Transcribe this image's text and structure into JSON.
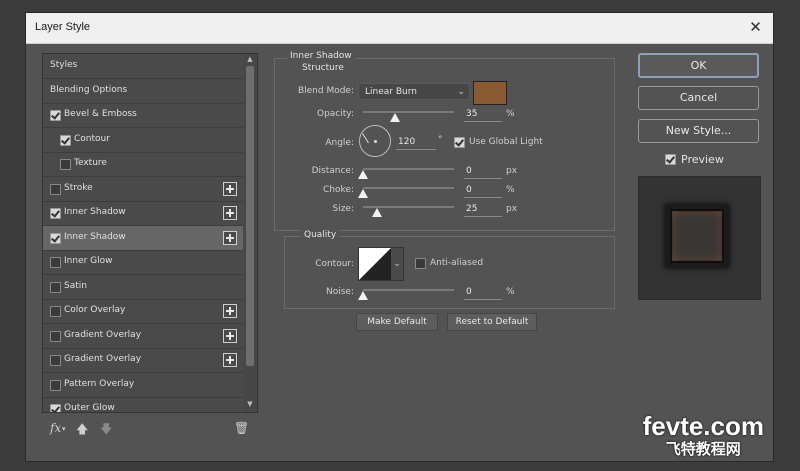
{
  "dialog": {
    "title": "Layer Style",
    "close_glyph": "✕"
  },
  "styles_list": {
    "items": [
      {
        "label": "Styles",
        "checkbox": null,
        "plus": false,
        "selected": false,
        "indent": 0
      },
      {
        "label": "Blending Options",
        "checkbox": null,
        "plus": false,
        "selected": false,
        "indent": 0
      },
      {
        "label": "Bevel & Emboss",
        "checkbox": true,
        "plus": false,
        "selected": false,
        "indent": 0
      },
      {
        "label": "Contour",
        "checkbox": true,
        "plus": false,
        "selected": false,
        "indent": 1
      },
      {
        "label": "Texture",
        "checkbox": false,
        "plus": false,
        "selected": false,
        "indent": 1
      },
      {
        "label": "Stroke",
        "checkbox": false,
        "plus": true,
        "selected": false,
        "indent": 0
      },
      {
        "label": "Inner Shadow",
        "checkbox": true,
        "plus": true,
        "selected": false,
        "indent": 0
      },
      {
        "label": "Inner Shadow",
        "checkbox": true,
        "plus": true,
        "selected": true,
        "indent": 0
      },
      {
        "label": "Inner Glow",
        "checkbox": false,
        "plus": false,
        "selected": false,
        "indent": 0
      },
      {
        "label": "Satin",
        "checkbox": false,
        "plus": false,
        "selected": false,
        "indent": 0
      },
      {
        "label": "Color Overlay",
        "checkbox": false,
        "plus": true,
        "selected": false,
        "indent": 0
      },
      {
        "label": "Gradient Overlay",
        "checkbox": false,
        "plus": true,
        "selected": false,
        "indent": 0
      },
      {
        "label": "Gradient Overlay",
        "checkbox": false,
        "plus": true,
        "selected": false,
        "indent": 0
      },
      {
        "label": "Pattern Overlay",
        "checkbox": false,
        "plus": false,
        "selected": false,
        "indent": 0
      },
      {
        "label": "Outer Glow",
        "checkbox": true,
        "plus": false,
        "selected": false,
        "indent": 0
      }
    ],
    "footer": {
      "fx": "fx",
      "up_icon": "arrow-up-icon",
      "down_icon": "arrow-down-icon",
      "trash_icon": "trash-icon"
    }
  },
  "inner_shadow": {
    "section_title": "Inner Shadow",
    "structure_title": "Structure",
    "blend_mode_label": "Blend Mode:",
    "blend_mode_value": "Linear Burn",
    "shadow_color": "#8a5a33",
    "opacity_label": "Opacity:",
    "opacity_value": "35",
    "angle_label": "Angle:",
    "angle_value": "120",
    "angle_unit": "°",
    "global_light_label": "Use Global Light",
    "global_light_checked": true,
    "distance_label": "Distance:",
    "distance_value": "0",
    "choke_label": "Choke:",
    "choke_value": "0",
    "size_label": "Size:",
    "size_value": "25",
    "px": "px",
    "percent": "%"
  },
  "quality": {
    "title": "Quality",
    "contour_label": "Contour:",
    "anti_aliased_label": "Anti-aliased",
    "anti_aliased_checked": false,
    "noise_label": "Noise:",
    "noise_value": "0",
    "percent": "%"
  },
  "buttons": {
    "make_default": "Make Default",
    "reset_default": "Reset to Default",
    "ok": "OK",
    "cancel": "Cancel",
    "new_style": "New Style...",
    "preview_label": "Preview",
    "preview_checked": true
  },
  "watermark": {
    "line1": "fevte.com",
    "line2": "飞特教程网"
  }
}
